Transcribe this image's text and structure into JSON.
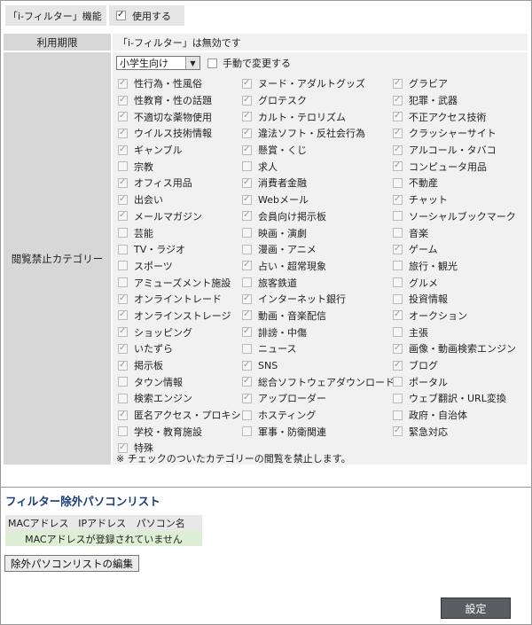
{
  "filter_feature": {
    "label": "「i-フィルター」機能",
    "checkbox_label": "使用する",
    "checked": true
  },
  "period": {
    "label": "利用期限",
    "value": "「i-フィルター」は無効です"
  },
  "categories": {
    "label": "閲覧禁止カテゴリー",
    "preset": "小学生向け",
    "manual_label": "手動で変更する",
    "manual_checked": false,
    "items": [
      {
        "label": "性行為・性風俗",
        "checked": true
      },
      {
        "label": "ヌード・アダルトグッズ",
        "checked": true
      },
      {
        "label": "グラビア",
        "checked": true
      },
      {
        "label": "性教育・性の話題",
        "checked": true
      },
      {
        "label": "グロテスク",
        "checked": true
      },
      {
        "label": "犯罪・武器",
        "checked": true
      },
      {
        "label": "不適切な薬物使用",
        "checked": true
      },
      {
        "label": "カルト・テロリズム",
        "checked": true
      },
      {
        "label": "不正アクセス技術",
        "checked": true
      },
      {
        "label": "ウイルス技術情報",
        "checked": true
      },
      {
        "label": "違法ソフト・反社会行為",
        "checked": true
      },
      {
        "label": "クラッシャーサイト",
        "checked": true
      },
      {
        "label": "ギャンブル",
        "checked": true
      },
      {
        "label": "懸賞・くじ",
        "checked": true
      },
      {
        "label": "アルコール・タバコ",
        "checked": true
      },
      {
        "label": "宗教",
        "checked": false
      },
      {
        "label": "求人",
        "checked": false
      },
      {
        "label": "コンピュータ用品",
        "checked": true
      },
      {
        "label": "オフィス用品",
        "checked": true
      },
      {
        "label": "消費者金融",
        "checked": true
      },
      {
        "label": "不動産",
        "checked": false
      },
      {
        "label": "出会い",
        "checked": true
      },
      {
        "label": "Webメール",
        "checked": true
      },
      {
        "label": "チャット",
        "checked": true
      },
      {
        "label": "メールマガジン",
        "checked": true
      },
      {
        "label": "会員向け掲示板",
        "checked": true
      },
      {
        "label": "ソーシャルブックマーク",
        "checked": false
      },
      {
        "label": "芸能",
        "checked": false
      },
      {
        "label": "映画・演劇",
        "checked": false
      },
      {
        "label": "音楽",
        "checked": false
      },
      {
        "label": "TV・ラジオ",
        "checked": false
      },
      {
        "label": "漫画・アニメ",
        "checked": false
      },
      {
        "label": "ゲーム",
        "checked": true
      },
      {
        "label": "スポーツ",
        "checked": false
      },
      {
        "label": "占い・超常現象",
        "checked": true
      },
      {
        "label": "旅行・観光",
        "checked": false
      },
      {
        "label": "アミューズメント施設",
        "checked": false
      },
      {
        "label": "旅客鉄道",
        "checked": false
      },
      {
        "label": "グルメ",
        "checked": false
      },
      {
        "label": "オンライントレード",
        "checked": true
      },
      {
        "label": "インターネット銀行",
        "checked": true
      },
      {
        "label": "投資情報",
        "checked": false
      },
      {
        "label": "オンラインストレージ",
        "checked": true
      },
      {
        "label": "動画・音楽配信",
        "checked": true
      },
      {
        "label": "オークション",
        "checked": true
      },
      {
        "label": "ショッピング",
        "checked": true
      },
      {
        "label": "誹謗・中傷",
        "checked": true
      },
      {
        "label": "主張",
        "checked": false
      },
      {
        "label": "いたずら",
        "checked": true
      },
      {
        "label": "ニュース",
        "checked": false
      },
      {
        "label": "画像・動画検索エンジン",
        "checked": true
      },
      {
        "label": "掲示板",
        "checked": true
      },
      {
        "label": "SNS",
        "checked": true
      },
      {
        "label": "ブログ",
        "checked": true
      },
      {
        "label": "タウン情報",
        "checked": false
      },
      {
        "label": "総合ソフトウェアダウンロード",
        "checked": true
      },
      {
        "label": "ポータル",
        "checked": false
      },
      {
        "label": "検索エンジン",
        "checked": false
      },
      {
        "label": "アップローダー",
        "checked": true
      },
      {
        "label": "ウェブ翻訳・URL変換",
        "checked": false
      },
      {
        "label": "匿名アクセス・プロキシ",
        "checked": true
      },
      {
        "label": "ホスティング",
        "checked": false
      },
      {
        "label": "政府・自治体",
        "checked": false
      },
      {
        "label": "学校・教育施設",
        "checked": false
      },
      {
        "label": "軍事・防衛関連",
        "checked": false
      },
      {
        "label": "緊急対応",
        "checked": true
      },
      {
        "label": "特殊",
        "checked": true
      }
    ],
    "note": "※ チェックのついたカテゴリーの閲覧を禁止します。"
  },
  "exclusion_list": {
    "title": "フィルター除外パソコンリスト",
    "columns": [
      "MACアドレス",
      "IPアドレス",
      "パソコン名"
    ],
    "empty_message": "MACアドレスが登録されていません",
    "edit_button": "除外パソコンリストの編集"
  },
  "submit_button": "設定"
}
